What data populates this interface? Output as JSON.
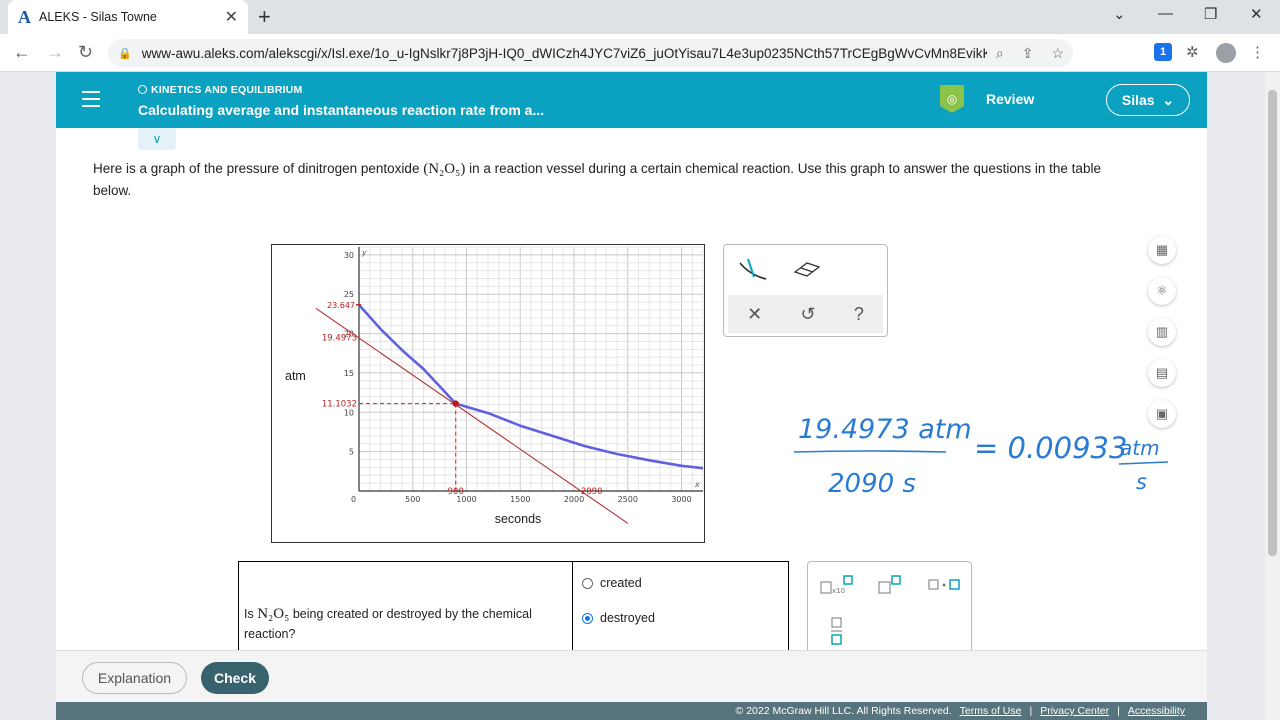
{
  "browser": {
    "tab_title": "ALEKS - Silas Towne",
    "tab_logo": "A",
    "url": "www-awu.aleks.com/alekscgi/x/Isl.exe/1o_u-IgNslkr7j8P3jH-IQ0_dWICzh4JYC7viZ6_juOtYisau7L4e3up0235NCth57TrCEgBgWvCvMn8EvikKpInN4...",
    "ext_badge": "1"
  },
  "header": {
    "topic": "KINETICS AND EQUILIBRIUM",
    "lesson": "Calculating average and instantaneous reaction rate from a...",
    "review_label": "Review",
    "user_label": "Silas"
  },
  "question": {
    "text_before": "Here is a graph of the pressure of dinitrogen pentoxide",
    "formula": "(N₂O₅)",
    "text_after": "in a reaction vessel during a certain chemical reaction. Use this graph to answer the questions in the table below."
  },
  "chart_data": {
    "type": "line",
    "xlabel": "seconds",
    "ylabel": "atm",
    "xlim": [
      0,
      3200
    ],
    "ylim": [
      0,
      31
    ],
    "x_ticks": [
      0,
      500,
      1000,
      1500,
      2000,
      2500,
      3000
    ],
    "y_ticks": [
      5,
      10,
      15,
      20,
      25,
      30
    ],
    "curve": {
      "x": [
        0,
        200,
        400,
        600,
        900,
        1200,
        1500,
        1800,
        2100,
        2400,
        2700,
        3000,
        3200
      ],
      "y": [
        23.647,
        20.6,
        17.9,
        15.5,
        11.1032,
        9.9,
        8.3,
        7.0,
        5.7,
        4.7,
        3.9,
        3.2,
        2.9
      ]
    },
    "tangent": {
      "x": [
        -400,
        2500
      ],
      "y": [
        23.2,
        -4.1
      ]
    },
    "annotations": {
      "y_start": "23.647",
      "y_intercept": "19.4973",
      "y_point": "11.1032",
      "x_point": "900",
      "x_intercept": "2090"
    }
  },
  "handwriting": {
    "numerator": "19.4973 atm",
    "denominator": "2090 s",
    "result": "= 0.00933",
    "unit_num": "atm",
    "unit_den": "s"
  },
  "table": {
    "question_before": "Is",
    "question_formula": "N₂O₅",
    "question_after": "being created or destroyed by the chemical reaction?",
    "options": [
      "created",
      "destroyed"
    ],
    "selected": "destroyed"
  },
  "mathpad": {
    "btn_sci": "□×10",
    "btn_sup": "□",
    "btn_dot": "□·□",
    "btn_frac": "□/□"
  },
  "footer": {
    "explanation": "Explanation",
    "check": "Check",
    "copyright": "© 2022 McGraw Hill LLC. All Rights Reserved.",
    "terms": "Terms of Use",
    "privacy": "Privacy Center",
    "accessibility": "Accessibility"
  }
}
